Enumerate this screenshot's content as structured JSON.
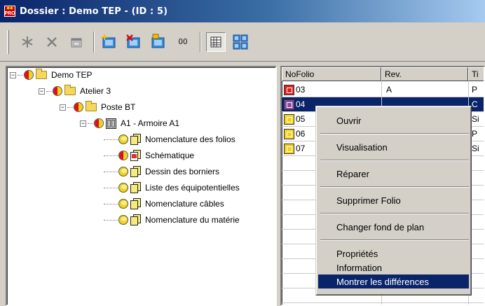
{
  "window": {
    "title": "Dossier : Demo TEP - (ID : 5)",
    "app_icon_text": [
      "PRO"
    ]
  },
  "toolbar": {
    "buttons": [
      {
        "name": "new-icon"
      },
      {
        "name": "delete-icon"
      },
      {
        "name": "properties-icon"
      },
      {
        "name": "add-folio-icon"
      },
      {
        "name": "remove-folio-icon"
      },
      {
        "name": "copy-folio-icon"
      },
      {
        "name": "oo-button",
        "text": "OO"
      },
      {
        "name": "list-view-icon"
      },
      {
        "name": "tree-view-icon"
      }
    ]
  },
  "tree": {
    "items": [
      {
        "label": "Demo TEP",
        "expander": "−"
      },
      {
        "label": "Atelier 3",
        "expander": "−"
      },
      {
        "label": "Poste BT",
        "expander": "−"
      },
      {
        "label": "A1 - Armoire A1",
        "expander": "−"
      },
      {
        "label": "Nomenclature des folios"
      },
      {
        "label": "Schématique"
      },
      {
        "label": "Dessin des borniers"
      },
      {
        "label": "Liste des équipotentielles"
      },
      {
        "label": "Nomenclature câbles"
      },
      {
        "label": "Nomenclature du matérie"
      }
    ]
  },
  "list": {
    "columns": [
      "NoFolio",
      "Rev.",
      "Ti"
    ],
    "rows": [
      {
        "folio": "03",
        "rev": "A",
        "title": "P",
        "icon": "red"
      },
      {
        "folio": "04",
        "rev": "",
        "title": "C",
        "icon": "purple",
        "selected": true
      },
      {
        "folio": "05",
        "rev": "",
        "title": "Si",
        "icon": "yellow"
      },
      {
        "folio": "06",
        "rev": "",
        "title": "P",
        "icon": "yellow"
      },
      {
        "folio": "07",
        "rev": "",
        "title": "Si",
        "icon": "yellow"
      }
    ]
  },
  "context_menu": {
    "items": [
      {
        "label": "Ouvrir"
      },
      {
        "label": "Visualisation"
      },
      {
        "label": "Réparer"
      },
      {
        "label": "Supprimer Folio"
      },
      {
        "label": "Changer fond de plan"
      },
      {
        "label": "Propriétés"
      },
      {
        "label": "Information"
      },
      {
        "label": "Montrer les différences",
        "highlighted": true
      }
    ]
  },
  "colors": {
    "title_bar": "#0a246a",
    "selection": "#0a246a",
    "face": "#d4d0c8"
  }
}
